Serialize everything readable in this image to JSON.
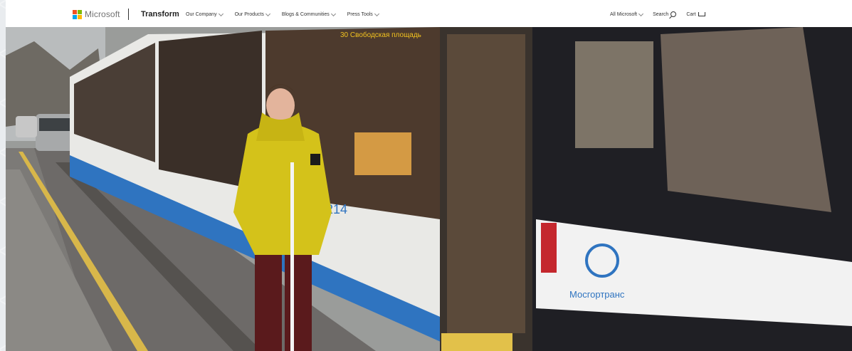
{
  "header": {
    "brand_name": "Microsoft",
    "site_title": "Transform",
    "nav": [
      {
        "label": "Our Company"
      },
      {
        "label": "Our Products"
      },
      {
        "label": "Blogs & Communities"
      },
      {
        "label": "Press Tools"
      }
    ],
    "all_microsoft": "All Microsoft",
    "search_label": "Search",
    "cart_label": "Cart"
  },
  "hero": {
    "tram_number": "61214",
    "tram_brand": "Мосгортранс",
    "destination_sign": "30 Свободская площадь"
  },
  "colors": {
    "ms_red": "#f25022",
    "ms_green": "#7fba00",
    "ms_blue": "#00a4ef",
    "ms_yellow": "#ffb900",
    "tram_blue": "#2f74c0",
    "jacket_yellow": "#d4c21a"
  }
}
